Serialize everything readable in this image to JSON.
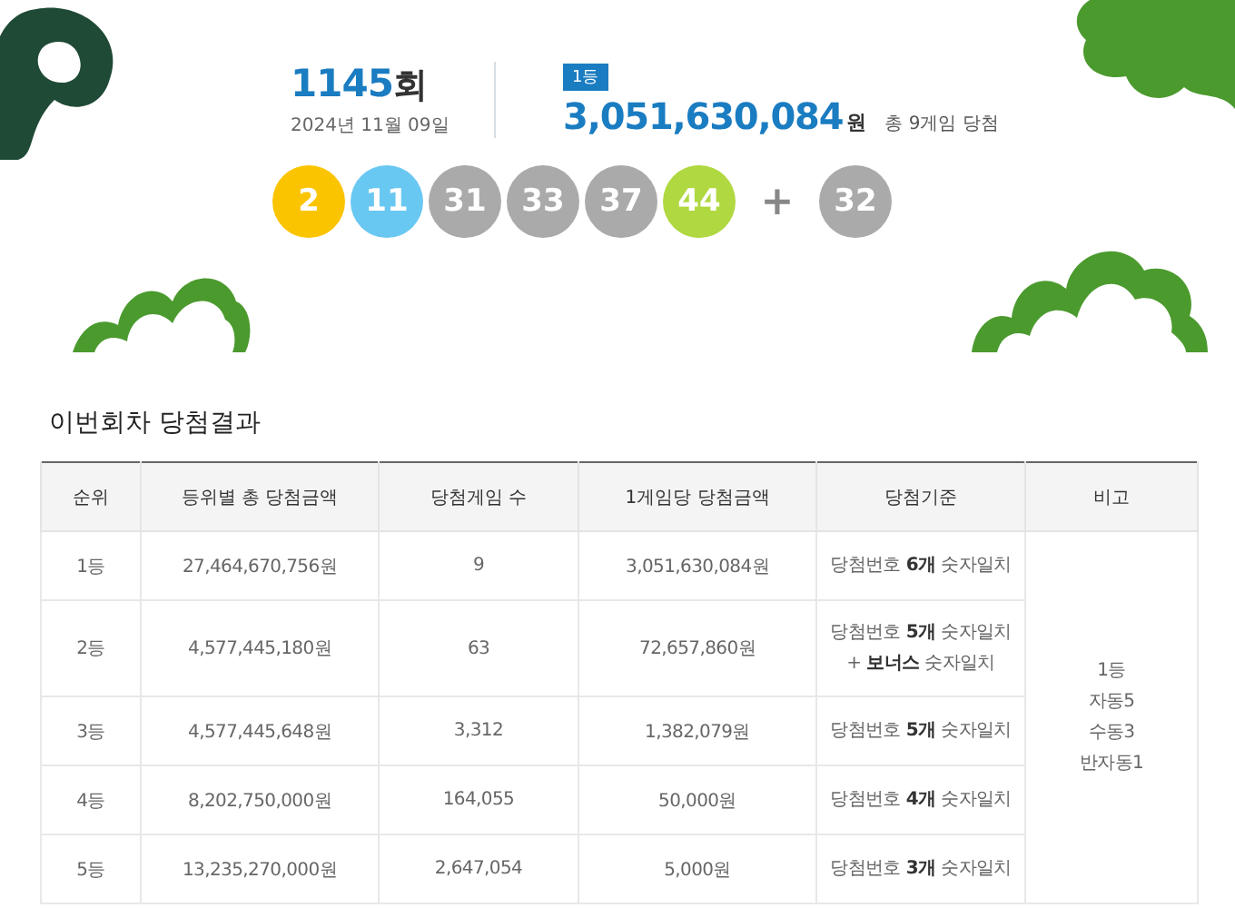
{
  "draw": {
    "round": "1145",
    "round_suffix": "회",
    "date": "2024년 11월 09일",
    "rank_badge": "1등",
    "first_prize": "3,051,630,084",
    "currency": "원",
    "winners_note": "총 9게임 당첨",
    "numbers": [
      {
        "number": "2",
        "color": "#fbc400"
      },
      {
        "number": "11",
        "color": "#69c8f2"
      },
      {
        "number": "31",
        "color": "#aaaaaa"
      },
      {
        "number": "33",
        "color": "#aaaaaa"
      },
      {
        "number": "37",
        "color": "#aaaaaa"
      },
      {
        "number": "44",
        "color": "#b0d840"
      }
    ],
    "plus": "+",
    "bonus": {
      "number": "32",
      "color": "#aaaaaa"
    }
  },
  "section_title": "이번회차 당첨결과",
  "table": {
    "columns": [
      "순위",
      "등위별 총 당첨금액",
      "당첨게임 수",
      "1게임당 당첨금액",
      "당첨기준",
      "비고"
    ],
    "rows": [
      {
        "rank": "1등",
        "total": "27,464,670,756원",
        "games": "9",
        "per_game": "3,051,630,084원",
        "criteria": [
          "당첨번호 **6개** 숫자일치"
        ]
      },
      {
        "rank": "2등",
        "total": "4,577,445,180원",
        "games": "63",
        "per_game": "72,657,860원",
        "criteria": [
          "당첨번호 **5개** 숫자일치",
          "+ **보너스** 숫자일치"
        ]
      },
      {
        "rank": "3등",
        "total": "4,577,445,648원",
        "games": "3,312",
        "per_game": "1,382,079원",
        "criteria": [
          "당첨번호 **5개** 숫자일치"
        ]
      },
      {
        "rank": "4등",
        "total": "8,202,750,000원",
        "games": "164,055",
        "per_game": "50,000원",
        "criteria": [
          "당첨번호 **4개** 숫자일치"
        ]
      },
      {
        "rank": "5등",
        "total": "13,235,270,000원",
        "games": "2,647,054",
        "per_game": "5,000원",
        "criteria": [
          "당첨번호 **3개** 숫자일치"
        ]
      }
    ],
    "notes": [
      "1등",
      "자동5",
      "수동3",
      "반자동1"
    ]
  }
}
